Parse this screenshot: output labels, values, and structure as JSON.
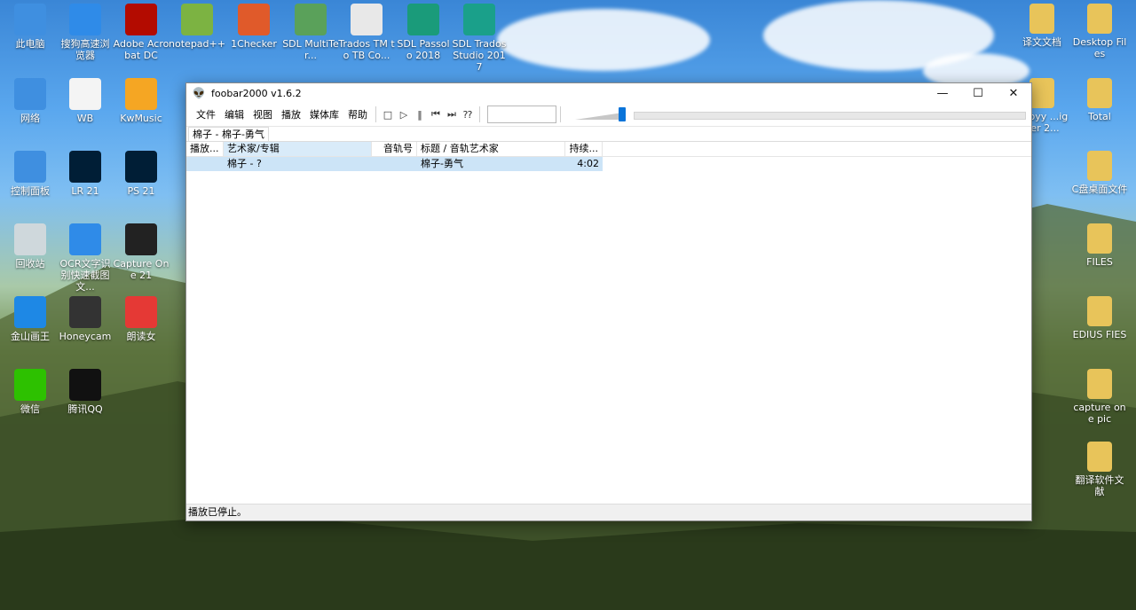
{
  "desktop": {
    "icons": [
      {
        "label": "此电脑",
        "icon": "computer-icon",
        "color": "#3f8fe0"
      },
      {
        "label": "搜狗高速浏览器",
        "icon": "sogou-browser-icon",
        "color": "#2f8be8"
      },
      {
        "label": "Adobe Acrobat DC",
        "icon": "acrobat-icon",
        "color": "#b30b00"
      },
      {
        "label": "notepad++",
        "icon": "notepadpp-icon",
        "color": "#7cb342"
      },
      {
        "label": "1Checker",
        "icon": "checker-icon",
        "color": "#e05a2a"
      },
      {
        "label": "SDL MultiTer...",
        "icon": "multiterm-icon",
        "color": "#5aa15a"
      },
      {
        "label": "Trados TM to TB Co...",
        "icon": "java-icon",
        "color": "#e8e8e8"
      },
      {
        "label": "SDL Passolo 2018",
        "icon": "passolo-icon",
        "color": "#1a9b7a"
      },
      {
        "label": "SDL Trados Studio 2017",
        "icon": "trados-icon",
        "color": "#1aa08a"
      },
      {
        "label": "网络",
        "icon": "network-icon",
        "color": "#3f8fe0"
      },
      {
        "label": "WB",
        "icon": "baidu-netdisk-icon",
        "color": "#f4f4f4"
      },
      {
        "label": "KwMusic",
        "icon": "kuwo-icon",
        "color": "#f5a623"
      },
      {
        "label": "控制面板",
        "icon": "control-panel-icon",
        "color": "#3f8fe0"
      },
      {
        "label": "LR 21",
        "icon": "lightroom-icon",
        "color": "#001e36"
      },
      {
        "label": "PS 21",
        "icon": "photoshop-icon",
        "color": "#001e36"
      },
      {
        "label": "回收站",
        "icon": "recycle-bin-icon",
        "color": "#cfd8dc"
      },
      {
        "label": "OCR文字识别快速截图文...",
        "icon": "ocr-icon",
        "color": "#2f8be8"
      },
      {
        "label": "Capture One 21",
        "icon": "capture-one-icon",
        "color": "#222"
      },
      {
        "label": "金山画王",
        "icon": "kingsoft-icon",
        "color": "#1e88e5"
      },
      {
        "label": "Honeycam",
        "icon": "honeycam-icon",
        "color": "#333"
      },
      {
        "label": "朗读女",
        "icon": "langdunv-icon",
        "color": "#e53935"
      },
      {
        "label": "微信",
        "icon": "wechat-icon",
        "color": "#2dc100"
      },
      {
        "label": "腾讯QQ",
        "icon": "qq-icon",
        "color": "#111"
      }
    ],
    "right_icons": [
      {
        "label": "译文文档",
        "icon": "folder-icon"
      },
      {
        "label": "Desktop Files",
        "icon": "folder-icon"
      },
      {
        "label": "Abbyy ...igner 2...",
        "icon": "abbyy-icon"
      },
      {
        "label": "Total",
        "icon": "folder-icon"
      },
      {
        "label": "C盘桌面文件",
        "icon": "folder-icon"
      },
      {
        "label": "FILES",
        "icon": "folder-icon"
      },
      {
        "label": "EDIUS FIES",
        "icon": "folder-icon"
      },
      {
        "label": "capture one pic",
        "icon": "folder-icon"
      },
      {
        "label": "翻译软件文献",
        "icon": "folder-icon"
      }
    ]
  },
  "window": {
    "title": "foobar2000 v1.6.2",
    "app_icon": "alien-icon",
    "controls": {
      "minimize": "—",
      "maximize": "☐",
      "close": "✕"
    },
    "menu": [
      "文件",
      "编辑",
      "视图",
      "播放",
      "媒体库",
      "帮助"
    ],
    "transport": [
      {
        "name": "stop-icon",
        "glyph": "□"
      },
      {
        "name": "play-icon",
        "glyph": "▷"
      },
      {
        "name": "pause-icon",
        "glyph": "‖"
      },
      {
        "name": "previous-icon",
        "glyph": "⏮"
      },
      {
        "name": "next-icon",
        "glyph": "⏭"
      },
      {
        "name": "random-icon",
        "glyph": "⁇"
      }
    ],
    "volume_level": 0.9,
    "playlist_tab": "棉子 - 棉子-勇气",
    "columns": [
      "播放...",
      "艺术家/专辑",
      "音轨号",
      "标题 / 音轨艺术家",
      "持续..."
    ],
    "rows": [
      {
        "playing": "",
        "artist_album": "棉子 - ?",
        "track": "",
        "title": "棉子-勇气",
        "duration": "4:02"
      }
    ],
    "status": "播放已停止。"
  }
}
